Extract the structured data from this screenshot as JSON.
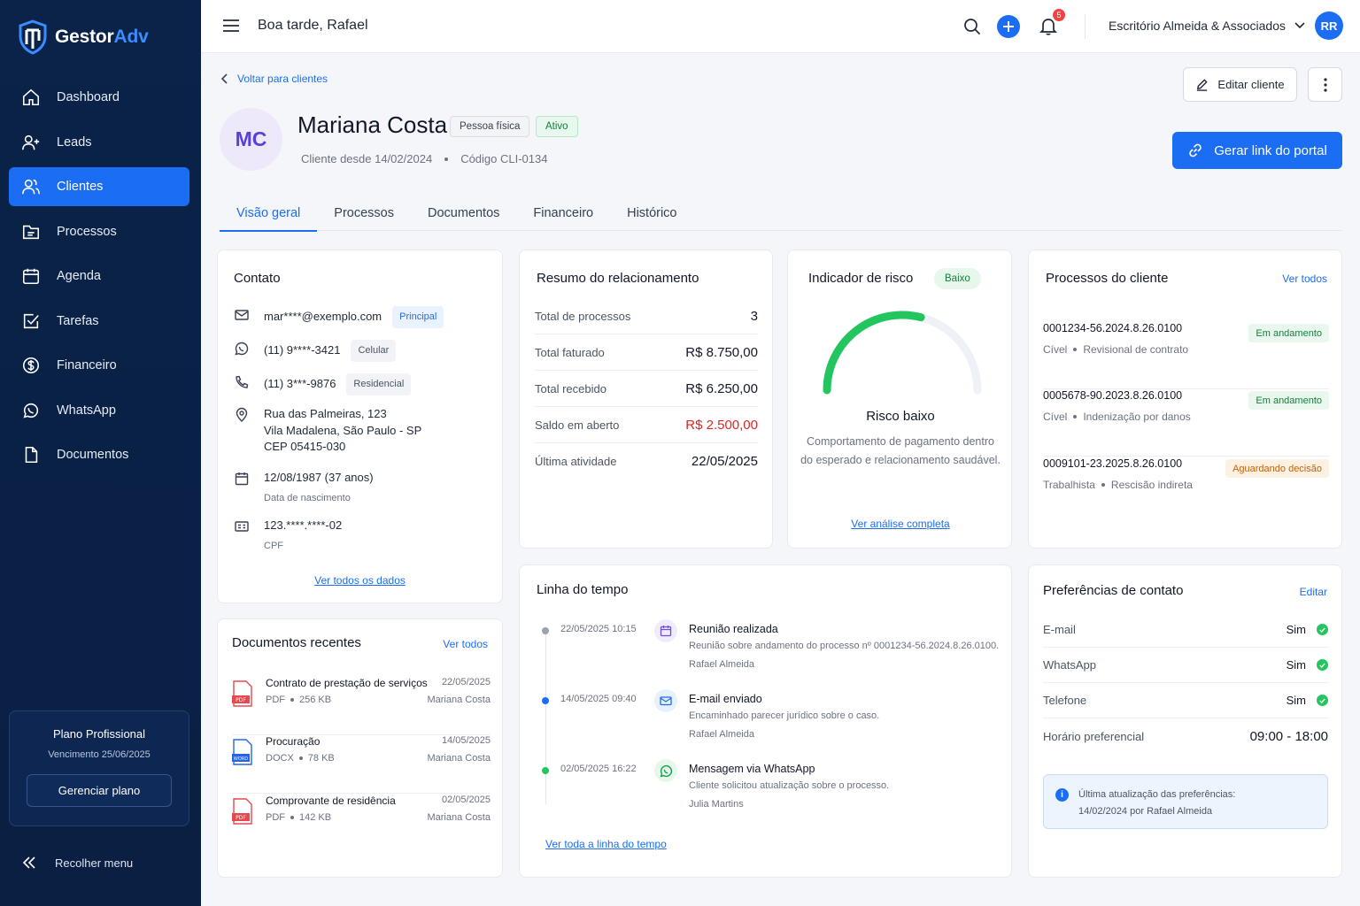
{
  "brand": {
    "name_main": "Gestor",
    "name_accent": "Adv"
  },
  "sidebar": {
    "items": [
      {
        "label": "Dashboard",
        "icon": "home-icon"
      },
      {
        "label": "Leads",
        "icon": "user-plus-icon"
      },
      {
        "label": "Clientes",
        "icon": "users-icon",
        "active": true
      },
      {
        "label": "Processos",
        "icon": "folder-icon"
      },
      {
        "label": "Agenda",
        "icon": "calendar-icon"
      },
      {
        "label": "Tarefas",
        "icon": "checkbox-icon"
      },
      {
        "label": "Financeiro",
        "icon": "dollar-icon"
      },
      {
        "label": "WhatsApp",
        "icon": "whatsapp-icon"
      },
      {
        "label": "Documentos",
        "icon": "document-icon"
      }
    ],
    "plan": {
      "title": "Plano Profissional",
      "due": "Vencimento 25/06/2025",
      "button": "Gerenciar plano"
    },
    "collapse": "Recolher menu"
  },
  "topbar": {
    "greeting": "Boa tarde, Rafael",
    "notifications": "5",
    "office": "Escritório Almeida & Associados",
    "avatar": "RR"
  },
  "header": {
    "back": "Voltar para clientes",
    "initials": "MC",
    "name": "Mariana Costa",
    "tag_type": "Pessoa física",
    "tag_status": "Ativo",
    "since": "Cliente desde 14/02/2024",
    "code": "Código CLI-0134",
    "edit": "Editar cliente",
    "portal": "Gerar link do portal"
  },
  "tabs": [
    "Visão geral",
    "Processos",
    "Documentos",
    "Financeiro",
    "Histórico"
  ],
  "contato": {
    "title": "Contato",
    "email": "mar****@exemplo.com",
    "email_tag": "Principal",
    "whats": "(11) 9****-3421",
    "whats_tag": "Celular",
    "phone": "(11) 3***-9876",
    "phone_tag": "Residencial",
    "addr1": "Rua das Palmeiras, 123",
    "addr2": "Vila Madalena, São Paulo - SP",
    "addr3": "CEP 05415-030",
    "birth": "12/08/1987 (37 anos)",
    "birth_label": "Data de nascimento",
    "cpf": "123.****.****-02",
    "cpf_label": "CPF",
    "link": "Ver todos os dados"
  },
  "resumo": {
    "title": "Resumo do relacionamento",
    "rows": [
      {
        "label": "Total de processos",
        "value": "3"
      },
      {
        "label": "Total faturado",
        "value": "R$ 8.750,00"
      },
      {
        "label": "Total recebido",
        "value": "R$ 6.250,00"
      },
      {
        "label": "Saldo em aberto",
        "value": "R$ 2.500,00"
      },
      {
        "label": "Última atividade",
        "value": "22/05/2025"
      }
    ]
  },
  "risco": {
    "title": "Indicador de risco",
    "badge": "Baixo",
    "gauge_fraction": 0.58,
    "label": "Risco baixo",
    "desc1": "Comportamento de pagamento dentro",
    "desc2": "do esperado e relacionamento saudável.",
    "link": "Ver análise completa",
    "color": "#22c55e"
  },
  "processos": {
    "title": "Processos do cliente",
    "link": "Ver todos",
    "items": [
      {
        "num": "0001234-56.2024.8.26.0100",
        "area": "Cível",
        "desc": "Revisional de contrato",
        "status": "Em andamento"
      },
      {
        "num": "0005678-90.2023.8.26.0100",
        "area": "Cível",
        "desc": "Indenização por danos",
        "status": "Em andamento"
      },
      {
        "num": "0009101-23.2025.8.26.0100",
        "area": "Trabalhista",
        "desc": "Rescisão indireta",
        "status": "Aguardando decisão"
      }
    ]
  },
  "docs": {
    "title": "Documentos recentes",
    "link": "Ver todos",
    "items": [
      {
        "name": "Contrato de prestação de serviços",
        "type": "PDF",
        "size": "256 KB",
        "date": "22/05/2025",
        "author": "Mariana Costa",
        "badge": "PDF"
      },
      {
        "name": "Procuração",
        "type": "DOCX",
        "size": "78 KB",
        "date": "14/05/2025",
        "author": "Mariana Costa",
        "badge": "WORD"
      },
      {
        "name": "Comprovante de residência",
        "type": "PDF",
        "size": "142 KB",
        "date": "02/05/2025",
        "author": "Mariana Costa",
        "badge": "PDF"
      }
    ]
  },
  "timeline": {
    "title": "Linha do tempo",
    "items": [
      {
        "date": "22/05/2025 10:15",
        "title": "Reunião realizada",
        "desc": "Reunião sobre andamento do processo nº 0001234-56.2024.8.26.0100.",
        "author": "Rafael Almeida"
      },
      {
        "date": "14/05/2025 09:40",
        "title": "E-mail enviado",
        "desc": "Encaminhado parecer jurídico sobre o caso.",
        "author": "Rafael Almeida"
      },
      {
        "date": "02/05/2025 16:22",
        "title": "Mensagem via WhatsApp",
        "desc": "Cliente solicitou atualização sobre o processo.",
        "author": "Julia Martins"
      }
    ],
    "link": "Ver toda a linha do tempo"
  },
  "prefs": {
    "title": "Preferências de contato",
    "edit": "Editar",
    "rows": [
      {
        "label": "E-mail",
        "value": "Sim"
      },
      {
        "label": "WhatsApp",
        "value": "Sim"
      },
      {
        "label": "Telefone",
        "value": "Sim"
      },
      {
        "label": "Horário preferencial",
        "value": "09:00 - 18:00"
      }
    ],
    "info1": "Última atualização das preferências:",
    "info2": "14/02/2024 por Rafael Almeida"
  }
}
